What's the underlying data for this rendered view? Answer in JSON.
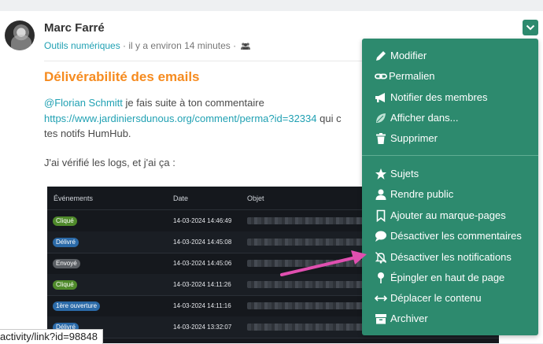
{
  "post": {
    "author": "Marc Farré",
    "space": "Outils numériques",
    "time_sep": " · ",
    "time": "il y a environ 14 minutes",
    "visibility_icon": "people-icon",
    "title": "Délivérabilité des emails",
    "line1_mention": "@Florian Schmitt",
    "line1_text": " je fais suite à ton commentaire",
    "line2_link": "https://www.jardiniersdunous.org/comment/perma?id=32334",
    "line2_text": " qui c",
    "line3_text": "tes notifs HumHub.",
    "line4_text": "J'ai vérifié les logs, et j'ai ça :"
  },
  "embed_table": {
    "headers": [
      "Événements",
      "Date",
      "Objet"
    ],
    "rows": [
      {
        "event": "Cliqué",
        "color": "#4f8a2b",
        "date": "14-03-2024 14:46:49"
      },
      {
        "event": "Délivré",
        "color": "#2b6aa8",
        "date": "14-03-2024 14:45:08"
      },
      {
        "event": "Envoyé",
        "color": "#5b5f64",
        "date": "14-03-2024 14:45:06"
      },
      {
        "event": "Cliqué",
        "color": "#4f8a2b",
        "date": "14-03-2024 14:11:26"
      },
      {
        "event": "1ère ouverture",
        "color": "#2b6aa8",
        "date": "14-03-2024 14:11:16"
      },
      {
        "event": "Délivré",
        "color": "#2b6aa8",
        "date": "14-03-2024 13:32:07"
      }
    ]
  },
  "menu": {
    "accent": "#2d8a6e",
    "items": [
      {
        "label": "Modifier",
        "icon": "pencil-icon"
      },
      {
        "label": "Permalien",
        "icon": "link-icon"
      },
      {
        "label": "Notifier des membres",
        "icon": "bullhorn-icon"
      },
      {
        "label": "Afficher dans...",
        "icon": "leaf-icon"
      },
      {
        "label": "Supprimer",
        "icon": "trash-icon"
      },
      {
        "label": "Sujets",
        "icon": "star-icon"
      },
      {
        "label": "Rendre public",
        "icon": "user-icon"
      },
      {
        "label": "Ajouter au marque-pages",
        "icon": "bookmark-icon"
      },
      {
        "label": "Désactiver les commentaires",
        "icon": "comment-icon"
      },
      {
        "label": "Désactiver les notifications",
        "icon": "bell-slash-icon"
      },
      {
        "label": "Épingler en haut de page",
        "icon": "pin-icon"
      },
      {
        "label": "Déplacer le contenu",
        "icon": "move-icon"
      },
      {
        "label": "Archiver",
        "icon": "archive-icon"
      }
    ]
  },
  "annotation_arrow_color": "#e04fb0",
  "status_bar": {
    "url": "activity/link?id=98848"
  }
}
